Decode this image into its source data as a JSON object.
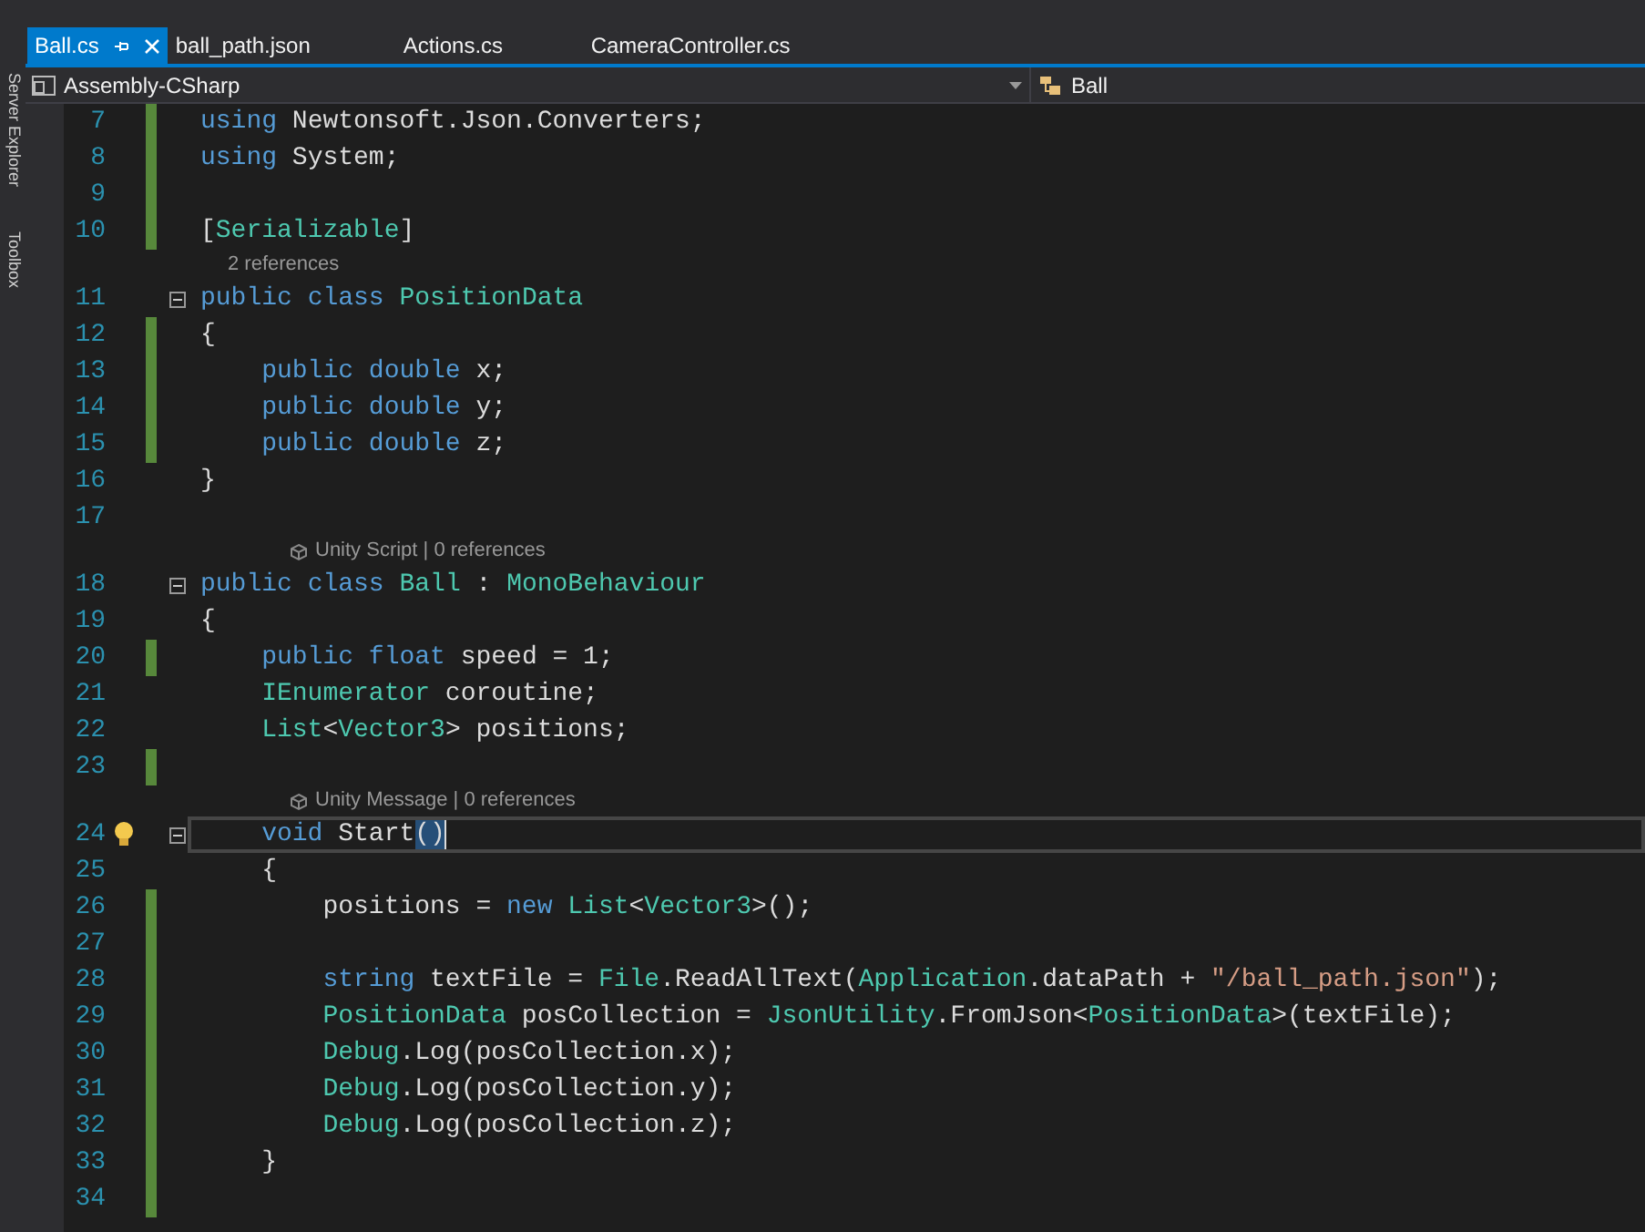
{
  "side_panel": {
    "labels": [
      "Server Explorer",
      "Toolbox"
    ]
  },
  "tabs": [
    {
      "label": "Ball.cs",
      "selected": true
    },
    {
      "label": "ball_path.json",
      "selected": false
    },
    {
      "label": "Actions.cs",
      "selected": false
    },
    {
      "label": "CameraController.cs",
      "selected": false
    }
  ],
  "nav_bar": {
    "project": "Assembly-CSharp",
    "member": "Ball"
  },
  "lines": [
    {
      "kind": "code",
      "number": "7",
      "changed": true,
      "tokens": [
        {
          "text": "using",
          "kind": "kw"
        },
        {
          "text": " Newtonsoft.Json.Converters;",
          "kind": "plain"
        }
      ]
    },
    {
      "kind": "code",
      "number": "8",
      "changed": true,
      "tokens": [
        {
          "text": "using",
          "kind": "kw"
        },
        {
          "text": " System;",
          "kind": "plain"
        }
      ]
    },
    {
      "kind": "code",
      "number": "9",
      "changed": true
    },
    {
      "kind": "code",
      "number": "10",
      "changed": true,
      "tokens": [
        {
          "text": "[",
          "kind": "plain"
        },
        {
          "text": "Serializable",
          "kind": "type"
        },
        {
          "text": "]",
          "kind": "plain"
        }
      ]
    },
    {
      "kind": "lens",
      "text": "2 references",
      "icon": false
    },
    {
      "kind": "code",
      "number": "11",
      "changed": false,
      "expanded": true,
      "tokens": [
        {
          "text": "public",
          "kind": "kw"
        },
        {
          "text": " class",
          "kind": "kw"
        },
        {
          "text": " PositionData",
          "kind": "type"
        }
      ]
    },
    {
      "kind": "code",
      "number": "12",
      "changed": true,
      "tokens": [
        {
          "text": "{",
          "kind": "plain"
        }
      ]
    },
    {
      "kind": "code",
      "number": "13",
      "changed": true,
      "tokens": [
        {
          "text": "    public",
          "kind": "kw"
        },
        {
          "text": " double",
          "kind": "kw"
        },
        {
          "text": " x;",
          "kind": "plain"
        }
      ]
    },
    {
      "kind": "code",
      "number": "14",
      "changed": true,
      "tokens": [
        {
          "text": "    public",
          "kind": "kw"
        },
        {
          "text": " double",
          "kind": "kw"
        },
        {
          "text": " y;",
          "kind": "plain"
        }
      ]
    },
    {
      "kind": "code",
      "number": "15",
      "changed": true,
      "tokens": [
        {
          "text": "    public",
          "kind": "kw"
        },
        {
          "text": " double",
          "kind": "kw"
        },
        {
          "text": " z;",
          "kind": "plain"
        }
      ]
    },
    {
      "kind": "code",
      "number": "16",
      "changed": false,
      "tokens": [
        {
          "text": "}",
          "kind": "plain"
        }
      ]
    },
    {
      "kind": "code",
      "number": "17",
      "changed": false
    },
    {
      "kind": "lens",
      "text": "Unity Script | 0 references",
      "icon": true
    },
    {
      "kind": "code",
      "number": "18",
      "changed": false,
      "expanded": true,
      "tokens": [
        {
          "text": "public",
          "kind": "kw"
        },
        {
          "text": " class",
          "kind": "kw"
        },
        {
          "text": " Ball",
          "kind": "type"
        },
        {
          "text": " : ",
          "kind": "plain"
        },
        {
          "text": "MonoBehaviour",
          "kind": "type"
        }
      ]
    },
    {
      "kind": "code",
      "number": "19",
      "changed": false,
      "tokens": [
        {
          "text": "{",
          "kind": "plain"
        }
      ]
    },
    {
      "kind": "code",
      "number": "20",
      "changed": true,
      "tokens": [
        {
          "text": "    public",
          "kind": "kw"
        },
        {
          "text": " float",
          "kind": "kw"
        },
        {
          "text": " speed = 1;",
          "kind": "plain"
        }
      ]
    },
    {
      "kind": "code",
      "number": "21",
      "changed": false,
      "tokens": [
        {
          "text": "    IEnumerator",
          "kind": "type"
        },
        {
          "text": " coroutine;",
          "kind": "plain"
        }
      ]
    },
    {
      "kind": "code",
      "number": "22",
      "changed": false,
      "tokens": [
        {
          "text": "    List",
          "kind": "type"
        },
        {
          "text": "<",
          "kind": "plain"
        },
        {
          "text": "Vector3",
          "kind": "type"
        },
        {
          "text": "> positions;",
          "kind": "plain"
        }
      ]
    },
    {
      "kind": "code",
      "number": "23",
      "changed": true
    },
    {
      "kind": "lens",
      "text": "Unity Message | 0 references",
      "icon": true
    },
    {
      "kind": "code",
      "number": "24",
      "changed": false,
      "current": true,
      "bulb": true,
      "expanded": true,
      "tokens": [
        {
          "text": "    void",
          "kind": "kw"
        },
        {
          "text": " Start",
          "kind": "plain"
        },
        {
          "text": "()",
          "kind": "match"
        }
      ]
    },
    {
      "kind": "code",
      "number": "25",
      "changed": false,
      "tokens": [
        {
          "text": "    {",
          "kind": "plain"
        }
      ]
    },
    {
      "kind": "code",
      "number": "26",
      "changed": true,
      "tokens": [
        {
          "text": "        positions = ",
          "kind": "plain"
        },
        {
          "text": "new",
          "kind": "kw"
        },
        {
          "text": " List",
          "kind": "type"
        },
        {
          "text": "<",
          "kind": "plain"
        },
        {
          "text": "Vector3",
          "kind": "type"
        },
        {
          "text": ">();",
          "kind": "plain"
        }
      ]
    },
    {
      "kind": "code",
      "number": "27",
      "changed": true
    },
    {
      "kind": "code",
      "number": "28",
      "changed": true,
      "tokens": [
        {
          "text": "        string",
          "kind": "kw"
        },
        {
          "text": " textFile = ",
          "kind": "plain"
        },
        {
          "text": "File",
          "kind": "type"
        },
        {
          "text": ".ReadAllText(",
          "kind": "plain"
        },
        {
          "text": "Application",
          "kind": "type"
        },
        {
          "text": ".dataPath + ",
          "kind": "plain"
        },
        {
          "text": "\"/ball_path.json\"",
          "kind": "string"
        },
        {
          "text": ");",
          "kind": "plain"
        }
      ]
    },
    {
      "kind": "code",
      "number": "29",
      "changed": true,
      "tokens": [
        {
          "text": "        PositionData",
          "kind": "type"
        },
        {
          "text": " posCollection = ",
          "kind": "plain"
        },
        {
          "text": "JsonUtility",
          "kind": "type"
        },
        {
          "text": ".FromJson<",
          "kind": "plain"
        },
        {
          "text": "PositionData",
          "kind": "type"
        },
        {
          "text": ">(textFile);",
          "kind": "plain"
        }
      ]
    },
    {
      "kind": "code",
      "number": "30",
      "changed": true,
      "tokens": [
        {
          "text": "        Debug",
          "kind": "type"
        },
        {
          "text": ".Log(posCollection.x);",
          "kind": "plain"
        }
      ]
    },
    {
      "kind": "code",
      "number": "31",
      "changed": true,
      "tokens": [
        {
          "text": "        Debug",
          "kind": "type"
        },
        {
          "text": ".Log(posCollection.y);",
          "kind": "plain"
        }
      ]
    },
    {
      "kind": "code",
      "number": "32",
      "changed": true,
      "tokens": [
        {
          "text": "        Debug",
          "kind": "type"
        },
        {
          "text": ".Log(posCollection.z);",
          "kind": "plain"
        }
      ]
    },
    {
      "kind": "code",
      "number": "33",
      "changed": true,
      "tokens": [
        {
          "text": "    }",
          "kind": "plain"
        }
      ]
    },
    {
      "kind": "code",
      "number": "34",
      "changed": true
    }
  ]
}
